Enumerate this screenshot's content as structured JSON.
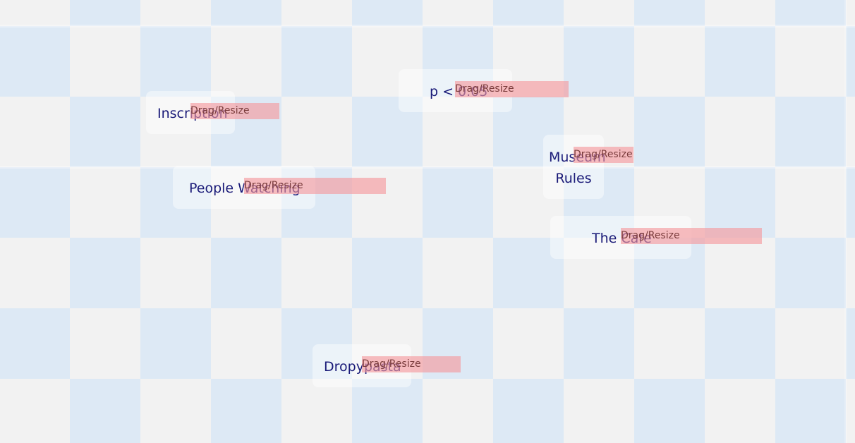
{
  "cards": [
    {
      "label": "Inscription",
      "handle_label": "Drag/Resize"
    },
    {
      "label": "p < 0.05",
      "handle_label": "Drag/Resize"
    },
    {
      "label": "Museum Rules",
      "handle_label": "Drag/Resize"
    },
    {
      "label": "People Watching",
      "handle_label": "Drag/Resize"
    },
    {
      "label": "The Cafe",
      "handle_label": "Drag/Resize"
    },
    {
      "label": "Dropypasta",
      "handle_label": "Drag/Resize"
    }
  ],
  "colors": {
    "background_light": "#f2f2f2",
    "background_blue": "#dde9f5",
    "card_text": "#1a1a78",
    "handle_fill": "#f5969b"
  }
}
